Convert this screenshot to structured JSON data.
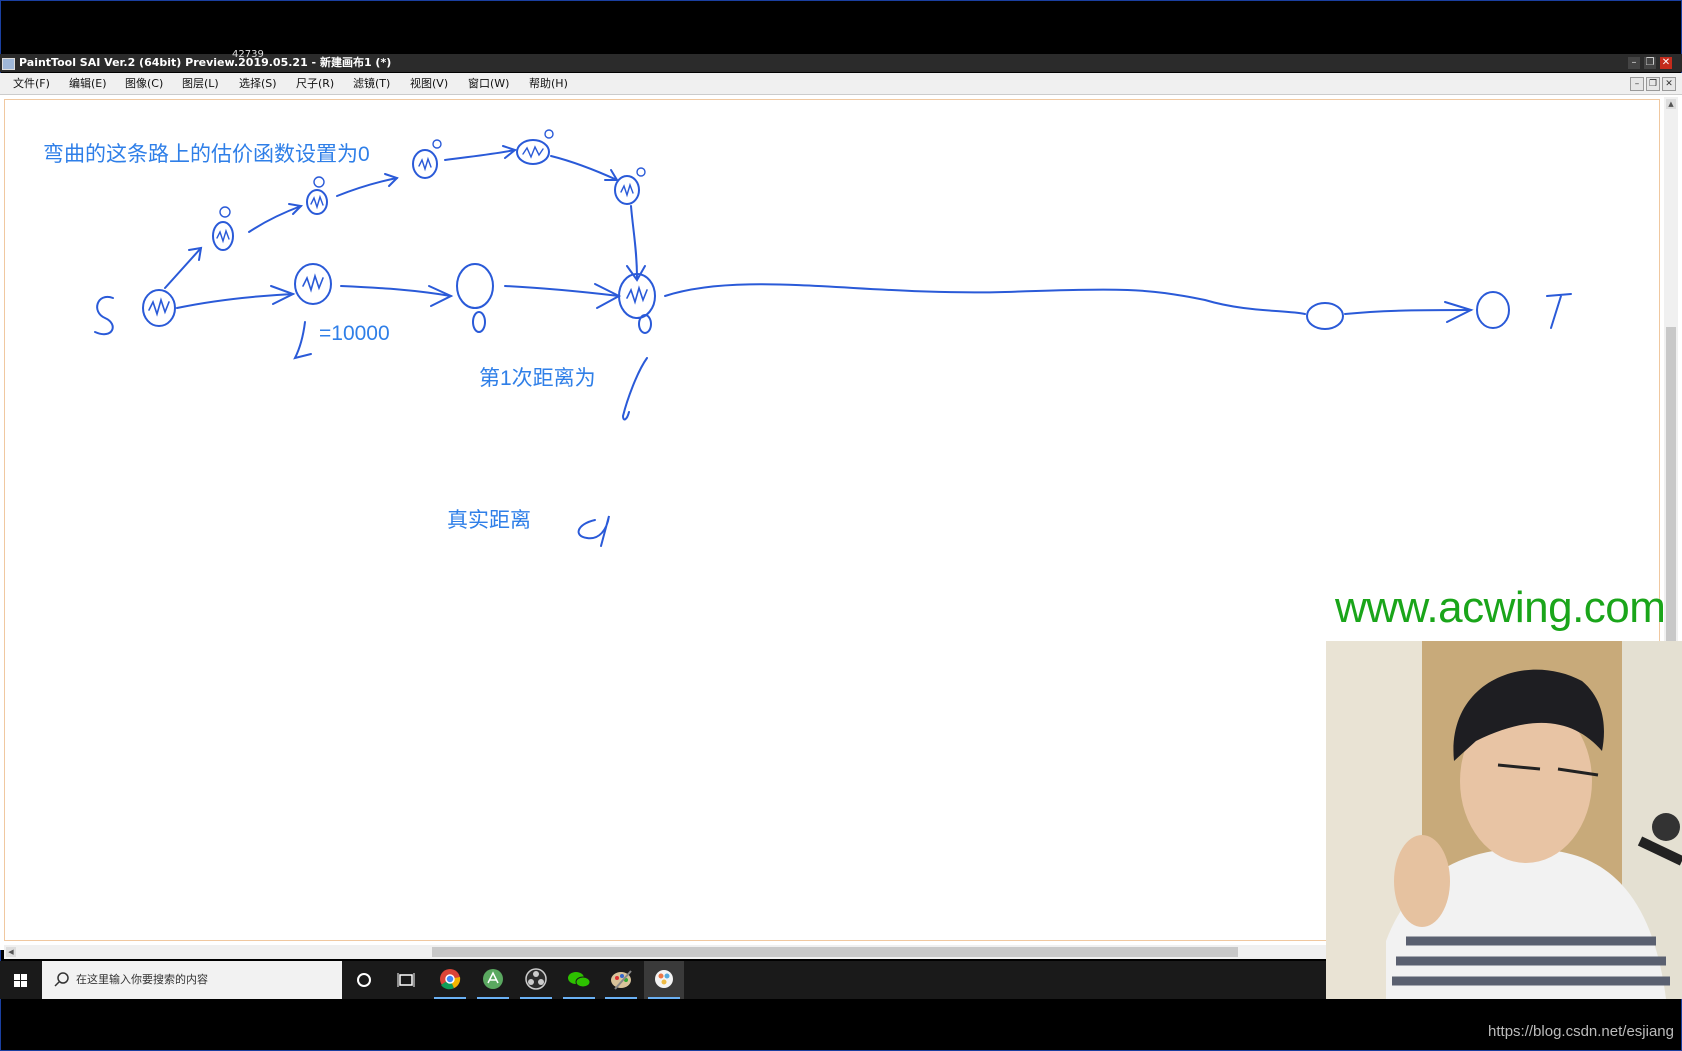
{
  "window": {
    "title": "PaintTool SAI Ver.2 (64bit) Preview.2019.05.21 - 新建画布1 (*)",
    "cursor_readout": "42739",
    "buttons": {
      "minimize": "–",
      "restore": "❐",
      "close": "✕"
    }
  },
  "menu": {
    "items": [
      {
        "label": "文件(F)"
      },
      {
        "label": "编辑(E)"
      },
      {
        "label": "图像(C)"
      },
      {
        "label": "图层(L)"
      },
      {
        "label": "选择(S)"
      },
      {
        "label": "尺子(R)"
      },
      {
        "label": "滤镜(T)"
      },
      {
        "label": "视图(V)"
      },
      {
        "label": "窗口(W)"
      },
      {
        "label": "帮助(H)"
      }
    ]
  },
  "canvas": {
    "annotations": {
      "heuristic_note": "弯曲的这条路上的估价函数设置为0",
      "edge_weight": "=10000",
      "first_distance": "第1次距离为",
      "true_distance": "真实距离",
      "source_label": "S",
      "target_label": "T",
      "weight_label": "L"
    },
    "ink_color": "#2f7fe8",
    "watermark": "www.acwing.com",
    "watermark_color": "#1aa51a"
  },
  "taskbar": {
    "search_placeholder": "在这里输入你要搜索的内容",
    "apps": [
      "cortana-icon",
      "task-view-icon",
      "chrome-icon",
      "app-store-icon",
      "obs-icon",
      "wechat-icon",
      "paint-icon",
      "sai-icon"
    ]
  },
  "footer": {
    "url": "https://blog.csdn.net/esjiang"
  }
}
